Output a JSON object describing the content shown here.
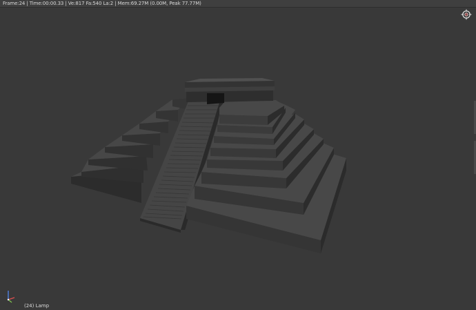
{
  "info_bar": {
    "text": "Frame:24 | Time:00:00.33 | Ve:817 Fa:540 La:2 | Mem:69.27M (0.00M, Peak 77.77M)"
  },
  "viewport": {
    "object_label": "(24) Lamp",
    "background_color": "#393939",
    "model": "stepped-pyramid-with-staircase"
  },
  "icons": {
    "split_widget": "area-split-icon",
    "axis_gizmo": "axis-orientation-icon"
  },
  "colors": {
    "axis_x": "#e05050",
    "axis_y": "#7fc04f",
    "axis_z": "#4f7fe0"
  }
}
